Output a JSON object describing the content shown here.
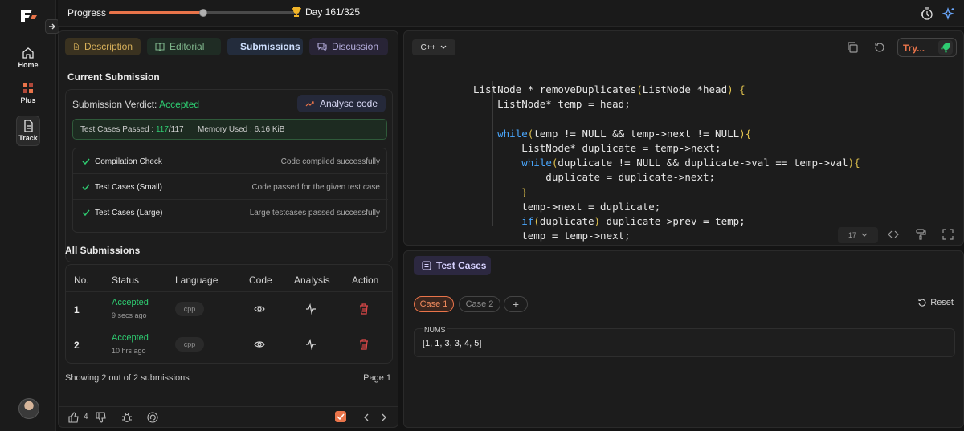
{
  "topbar": {
    "progress_label": "Progress",
    "progress_fraction": 0.495,
    "day_text": "Day 161/325"
  },
  "rail": {
    "home": "Home",
    "plus": "Plus",
    "track": "Track"
  },
  "tabs": {
    "description": "Description",
    "editorial": "Editorial",
    "submissions": "Submissions",
    "discussion": "Discussion"
  },
  "current": {
    "title": "Current Submission",
    "verdict_prefix": "Submission Verdict: ",
    "verdict": "Accepted",
    "analyse_label": "Analyse code",
    "tests_prefix": "Test Cases Passed : ",
    "tests_passed": "117",
    "tests_total": "/117",
    "memory": "Memory Used : 6.16 KiB",
    "checks": [
      {
        "name": "Compilation Check",
        "desc": "Code compiled successfully"
      },
      {
        "name": "Test Cases (Small)",
        "desc": "Code passed for the given test case"
      },
      {
        "name": "Test Cases (Large)",
        "desc": "Large testcases passed successfully"
      }
    ]
  },
  "all": {
    "title": "All Submissions",
    "headers": [
      "No.",
      "Status",
      "Language",
      "Code",
      "Analysis",
      "Action"
    ],
    "rows": [
      {
        "no": "1",
        "status": "Accepted",
        "time": "9 secs ago",
        "lang": "cpp"
      },
      {
        "no": "2",
        "status": "Accepted",
        "time": "10 hrs ago",
        "lang": "cpp"
      }
    ],
    "showing": "Showing 2 out of 2 submissions",
    "page": "Page 1"
  },
  "footer": {
    "likes": "4"
  },
  "editor": {
    "language": "C++",
    "try_label": "Try...",
    "line_select": "17",
    "code_lines": [
      "ListNode * removeDuplicates(ListNode *head) {",
      "    ListNode* temp = head;",
      "",
      "    while(temp != NULL && temp->next != NULL){",
      "        ListNode* duplicate = temp->next;",
      "        while(duplicate != NULL && duplicate->val == temp->val){",
      "            duplicate = duplicate->next;",
      "        }",
      "        temp->next = duplicate;",
      "        if(duplicate) duplicate->prev = temp;",
      "        temp = temp->next;"
    ]
  },
  "testcases": {
    "tab_label": "Test Cases",
    "case1": "Case 1",
    "case2": "Case 2",
    "add": "+",
    "reset": "Reset",
    "field_label": "NUMS",
    "field_value": "[1, 1, 3, 3, 4, 5]"
  },
  "colors": {
    "accent": "#e9744a",
    "success": "#2ecc71",
    "danger": "#e04848"
  }
}
